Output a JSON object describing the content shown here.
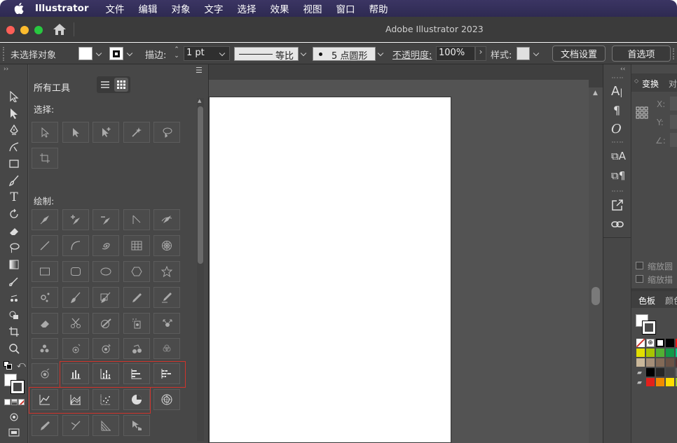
{
  "menubar": {
    "app_name": "Illustrator",
    "items": [
      "文件",
      "编辑",
      "对象",
      "文字",
      "选择",
      "效果",
      "视图",
      "窗口",
      "帮助"
    ]
  },
  "window": {
    "title": "Adobe Illustrator 2023"
  },
  "control_bar": {
    "selection_label": "未选择对象",
    "stroke_label": "描边:",
    "stroke_value": "1 pt",
    "profile_label": "等比",
    "brush_value": "5 点圆形",
    "opacity_label": "不透明度:",
    "opacity_value": "100%",
    "style_label": "样式:",
    "doc_settings_button": "文档设置",
    "preferences_button": "首选项"
  },
  "tools_panel": {
    "title": "所有工具",
    "sections": {
      "select": "选择:",
      "draw": "绘制:"
    }
  },
  "right_panel": {
    "tab_transform": "变换",
    "tab_align_partial": "对",
    "x_label": "X:",
    "y_label": "Y:",
    "angle_label": "∠:",
    "checkbox_scale_corners": "缩放圆",
    "checkbox_scale_strokes": "缩放描",
    "tab_swatches": "色板",
    "tab_color_partial": "颜色"
  },
  "colors": {
    "menubar": "#2e2a52",
    "highlight": "#d0342c",
    "close": "#fe5f57",
    "minimize": "#febc2e",
    "zoom": "#28c840"
  }
}
